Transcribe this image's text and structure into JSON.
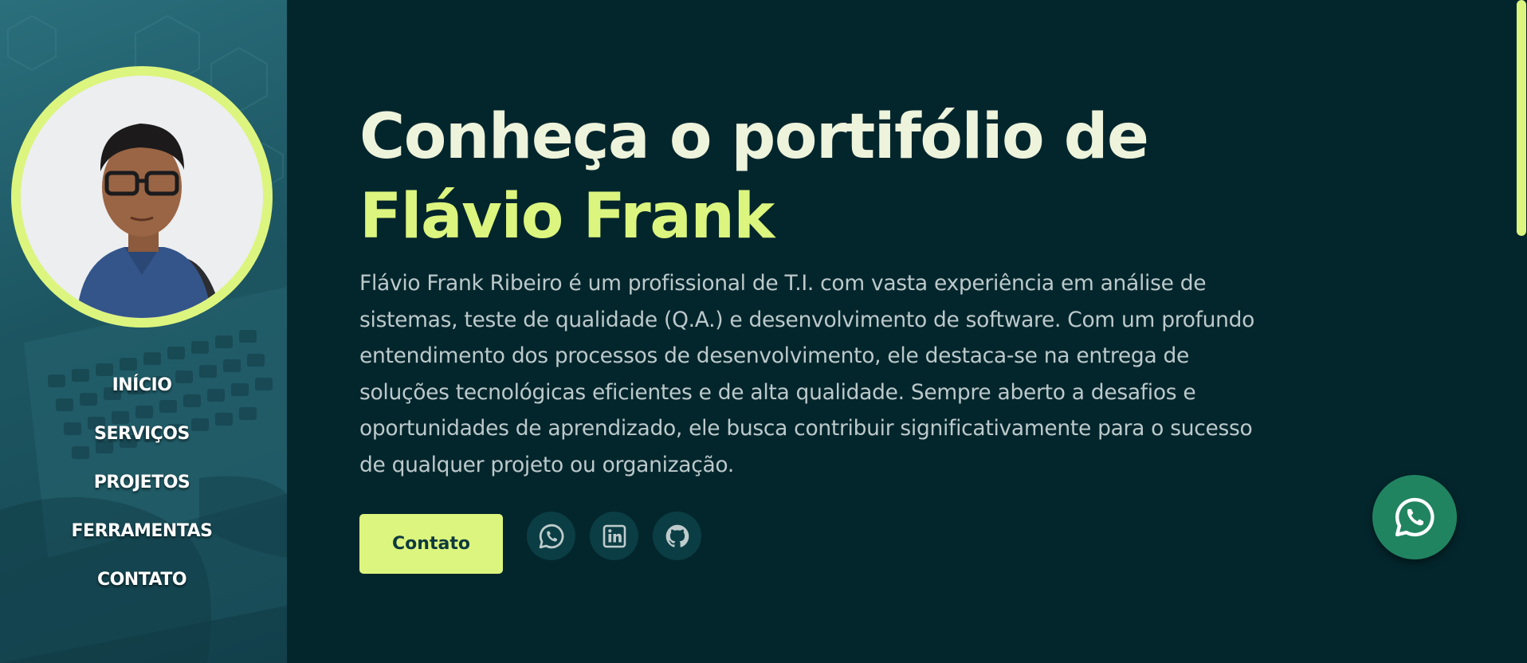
{
  "sidebar": {
    "nav": [
      {
        "label": "INÍCIO"
      },
      {
        "label": "SERVIÇOS"
      },
      {
        "label": "PROJETOS"
      },
      {
        "label": "FERRAMENTAS"
      },
      {
        "label": "CONTATO"
      }
    ]
  },
  "hero": {
    "title_line1": "Conheça o portifólio de",
    "title_line2": "Flávio Frank",
    "description": "Flávio Frank Ribeiro é um profissional de T.I. com vasta experiência em análise de sistemas, teste de qualidade (Q.A.) e desenvolvimento de software. Com um profundo entendimento dos processos de desenvolvimento, ele destaca-se na entrega de soluções tecnológicas eficientes e de alta qualidade. Sempre aberto a desafios e oportunidades de aprendizado, ele busca contribuir significativamente para o sucesso de qualquer projeto ou organização.",
    "contact_button": "Contato"
  },
  "social_icons": [
    "whatsapp-icon",
    "linkedin-icon",
    "github-icon"
  ],
  "floating_button_icon": "whatsapp-icon",
  "colors": {
    "background": "#03262c",
    "accent": "#dcf57e",
    "title": "#eef3dc",
    "text": "#bcc9cb",
    "whatsapp_float": "#218461",
    "sidebar": "#1f5a67"
  }
}
